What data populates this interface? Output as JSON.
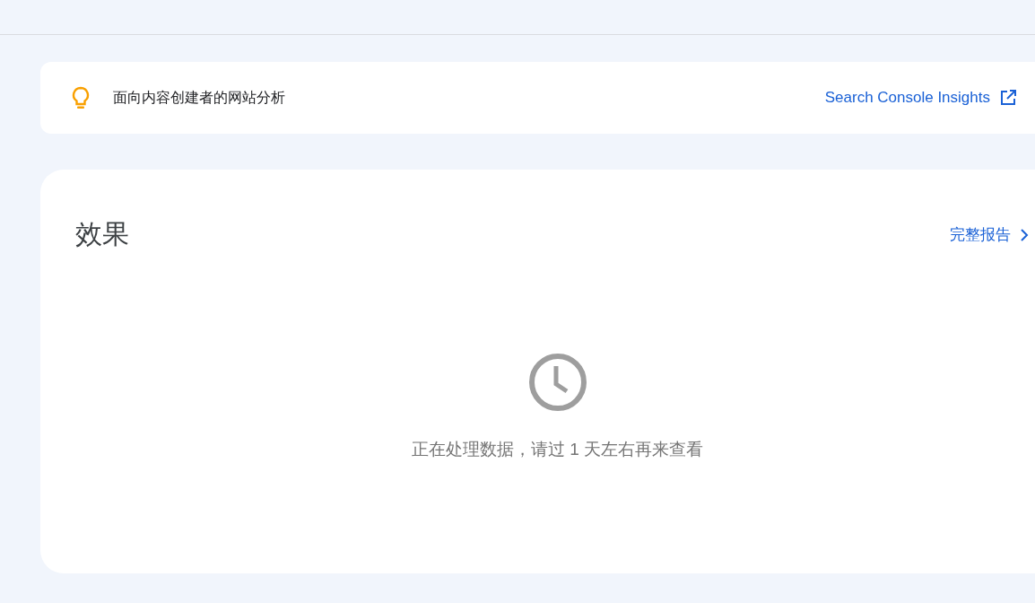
{
  "banner": {
    "text": "面向内容创建者的网站分析",
    "link": "Search Console Insights"
  },
  "performance": {
    "title": "效果",
    "link": "完整报告",
    "message": "正在处理数据，请过 1 天左右再来查看"
  }
}
